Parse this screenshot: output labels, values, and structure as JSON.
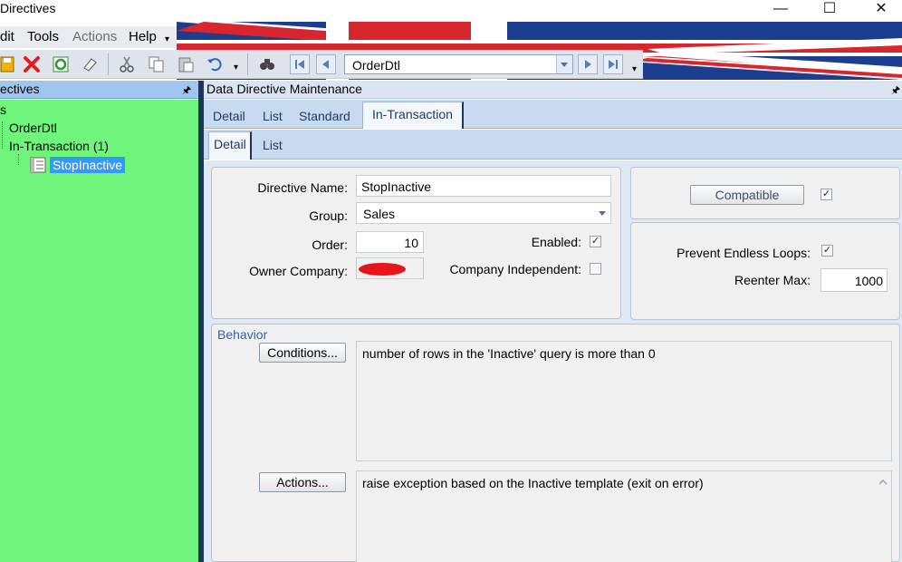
{
  "window": {
    "title": "Directives",
    "minimize_glyph": "—",
    "maximize_glyph": "☐",
    "close_glyph": "✕"
  },
  "menubar": {
    "items": [
      {
        "label": "dit",
        "disabled": false
      },
      {
        "label": "Tools",
        "disabled": false
      },
      {
        "label": "Actions",
        "disabled": true
      },
      {
        "label": "Help",
        "disabled": false
      }
    ]
  },
  "toolbar": {
    "icons": [
      "save-icon",
      "delete-icon",
      "refresh-icon",
      "clear-icon",
      "cut-icon",
      "copy-icon",
      "paste-icon",
      "undo-icon",
      "search-icon"
    ],
    "navigator": {
      "value": "OrderDtl"
    }
  },
  "tree": {
    "title": "ectives",
    "pin_glyph": "🖈",
    "items": [
      {
        "label": "s"
      },
      {
        "label": "OrderDtl"
      },
      {
        "label": "In-Transaction (1)"
      },
      {
        "label": "StopInactive",
        "selected": true
      }
    ]
  },
  "main": {
    "title": "Data Directive Maintenance",
    "tabs": [
      "Detail",
      "List",
      "Standard",
      "In-Transaction"
    ],
    "active_tab": "In-Transaction",
    "subtabs": [
      "Detail",
      "List"
    ],
    "active_subtab": "Detail",
    "form": {
      "directive_name_label": "Directive Name:",
      "directive_name": "StopInactive",
      "group_label": "Group:",
      "group": "Sales",
      "order_label": "Order:",
      "order": "10",
      "enabled_label": "Enabled:",
      "enabled": true,
      "owner_company_label": "Owner Company:",
      "company_independent_label": "Company Independent:",
      "company_independent": false
    },
    "compat": {
      "compatible_label": "Compatible",
      "compatible": true,
      "prevent_loops_label": "Prevent Endless Loops:",
      "prevent_loops": true,
      "reenter_max_label": "Reenter Max:",
      "reenter_max": "1000"
    },
    "behavior": {
      "title": "Behavior",
      "conditions_label": "Conditions...",
      "conditions_text": "number of rows in the 'Inactive' query is more than 0",
      "actions_label": "Actions...",
      "actions_text": "raise exception based on the Inactive template  (exit on error)"
    }
  },
  "colors": {
    "tree_bg": "#6ff57b",
    "selection": "#3399ff",
    "splitter": "#1f3554",
    "flag_blue": "#1d3d8f",
    "flag_red": "#d8262f"
  }
}
